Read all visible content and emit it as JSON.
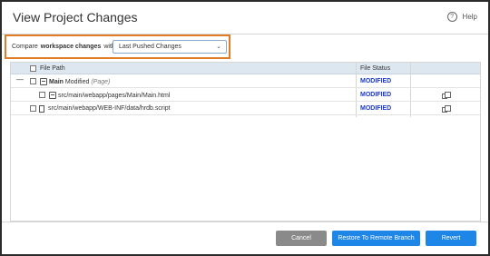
{
  "dialog": {
    "title": "View Project Changes",
    "help_label": "Help",
    "help_icon": "?"
  },
  "compare": {
    "prefix": "Compare",
    "bold": "workspace changes",
    "suffix": "with",
    "selected": "Last Pushed Changes",
    "chevron": "⌄"
  },
  "table": {
    "headers": {
      "file_path": "File Path",
      "file_status": "File Status"
    },
    "rows": [
      {
        "name": "Main",
        "suffix": "Modified",
        "italic": "(Page)",
        "status": "MODIFIED"
      },
      {
        "path": "src/main/webapp/pages/Main/Main.html",
        "status": "MODIFIED"
      },
      {
        "path": "src/main/webapp/WEB-INF/data/hrdb.script",
        "status": "MODIFIED"
      }
    ],
    "collapse_symbol": "—"
  },
  "footer": {
    "cancel": "Cancel",
    "restore": "Restore To Remote Branch",
    "revert": "Revert"
  },
  "colors": {
    "accent": "#1e86e6",
    "highlight_border": "#e07b27",
    "status": "#1a39c8",
    "header_bg": "#dde7f0"
  }
}
